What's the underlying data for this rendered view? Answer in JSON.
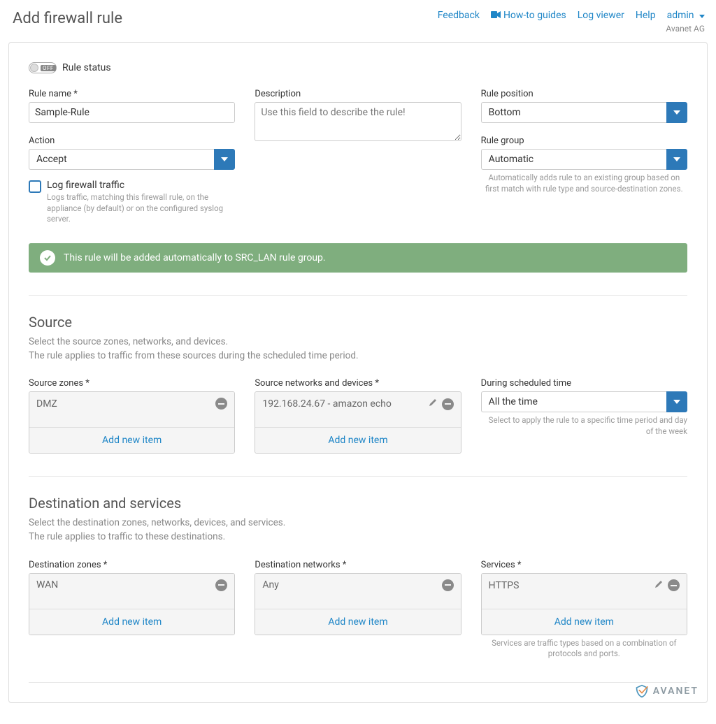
{
  "header": {
    "title": "Add firewall rule",
    "links": {
      "feedback": "Feedback",
      "howto": "How-to guides",
      "logviewer": "Log viewer",
      "help": "Help",
      "user": "admin"
    },
    "brand_sub": "Avanet AG"
  },
  "basic": {
    "toggle_off_text": "OFF",
    "toggle_label": "Rule status",
    "name_label": "Rule name",
    "name_value": "Sample-Rule",
    "desc_label": "Description",
    "desc_placeholder": "Use this field to describe the rule!",
    "action_label": "Action",
    "action_value": "Accept",
    "pos_label": "Rule position",
    "pos_value": "Bottom",
    "group_label": "Rule group",
    "group_value": "Automatic",
    "group_help": "Automatically adds rule to an existing group based on first match with rule type and source-destination zones.",
    "log_label": "Log firewall traffic",
    "log_help": "Logs traffic, matching this firewall rule, on the appliance (by default) or on the configured syslog server.",
    "banner_text": "This rule will be added automatically to SRC_LAN rule group."
  },
  "source": {
    "title": "Source",
    "desc_line1": "Select the source zones, networks, and devices.",
    "desc_line2": "The rule applies to traffic from these sources during the scheduled time period.",
    "zones_label": "Source zones",
    "zones_item0": "DMZ",
    "nets_label": "Source networks and devices",
    "nets_item0": "192.168.24.67 - amazon echo",
    "sched_label": "During scheduled time",
    "sched_value": "All the time",
    "sched_help": "Select to apply the rule to a specific time period and day of the week",
    "add_new": "Add new item"
  },
  "dest": {
    "title": "Destination and services",
    "desc_line1": "Select the destination zones, networks, devices, and services.",
    "desc_line2": "The rule applies to traffic to these destinations.",
    "zones_label": "Destination zones",
    "zones_item0": "WAN",
    "nets_label": "Destination networks",
    "nets_item0": "Any",
    "serv_label": "Services",
    "serv_item0": "HTTPS",
    "serv_help": "Services are traffic types based on a combination of protocols and ports.",
    "add_new": "Add new item"
  },
  "watermark": "AVANET"
}
